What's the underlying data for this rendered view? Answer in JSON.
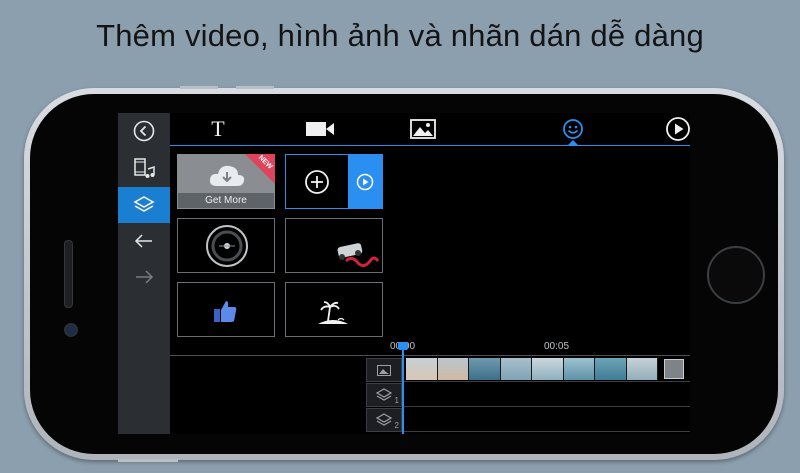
{
  "headline": "Thêm video, hình ảnh và nhãn dán dễ dàng",
  "colors": {
    "accent": "#2a8ff0",
    "active_sidebar": "#1b7fd1",
    "badge": "#e0435c",
    "background": "#8c9fae"
  },
  "sidebar": {
    "items": [
      {
        "icon": "back-circle-icon"
      },
      {
        "icon": "media-clip-icon"
      },
      {
        "icon": "layers-icon",
        "active": true
      },
      {
        "icon": "undo-icon"
      },
      {
        "icon": "redo-icon"
      }
    ]
  },
  "tabs": [
    {
      "icon": "text-icon",
      "glyph": "T"
    },
    {
      "icon": "video-camera-icon"
    },
    {
      "icon": "image-icon"
    },
    {
      "icon": "sticker-smiley-icon",
      "active": true
    },
    {
      "icon": "play-circle-icon"
    }
  ],
  "stickers": {
    "get_more_label": "Get More",
    "new_badge": "NEW",
    "items": [
      "add-sticker",
      "circle-sticker",
      "car-sticker",
      "thumbs-up-sticker",
      "island-sticker"
    ]
  },
  "timeline": {
    "time_labels": [
      "00:00",
      "00:05"
    ],
    "tracks": [
      {
        "icon": "image-track-icon",
        "number": ""
      },
      {
        "icon": "layer-track-icon",
        "number": "1"
      },
      {
        "icon": "layer-track-icon",
        "number": "2"
      }
    ]
  }
}
